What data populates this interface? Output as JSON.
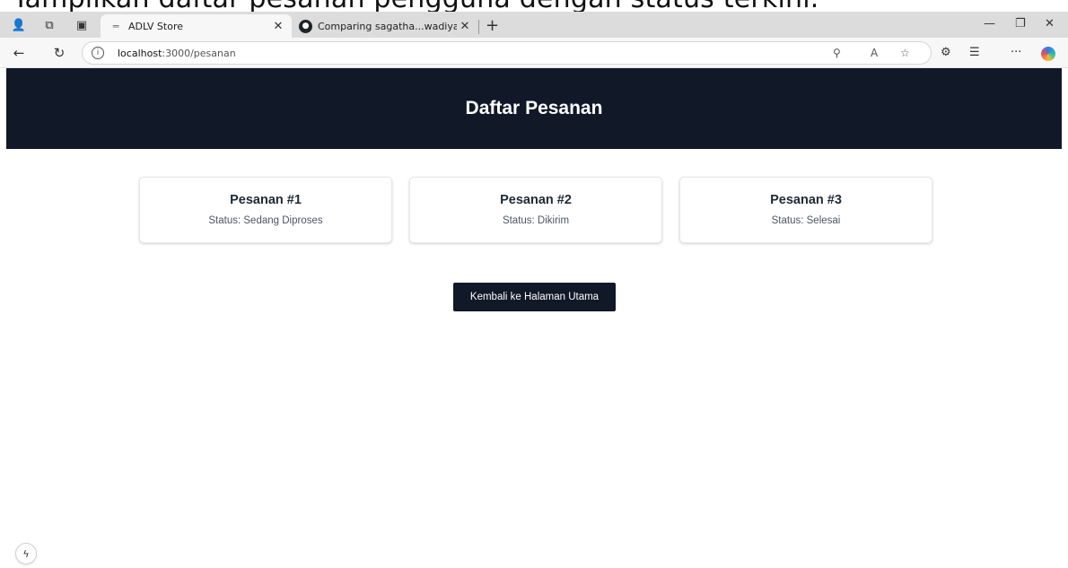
{
  "top_strip": {
    "text": "Tampilkan daftar pesanan pengguna dengan status terkini."
  },
  "browser": {
    "tabs": [
      {
        "title": "ADLV Store",
        "active": true,
        "icon": "page-icon"
      },
      {
        "title": "Comparing sagatha...wadiyan · wa",
        "active": false,
        "icon": "github-icon"
      }
    ],
    "address": {
      "host": "localhost",
      "path": ":3000/pesanan"
    }
  },
  "page": {
    "title": "Daftar Pesanan",
    "orders": [
      {
        "title": "Pesanan #1",
        "status": "Status: Sedang Diproses"
      },
      {
        "title": "Pesanan #2",
        "status": "Status: Dikirim"
      },
      {
        "title": "Pesanan #3",
        "status": "Status: Selesai"
      }
    ],
    "back_button": "Kembali ke Halaman Utama"
  },
  "dev_indicator": {
    "icon": "lightning-icon",
    "glyph": "ϟ"
  },
  "colors": {
    "header_bg": "#111827",
    "button_bg": "#111827",
    "card_border": "#e5e7eb"
  }
}
